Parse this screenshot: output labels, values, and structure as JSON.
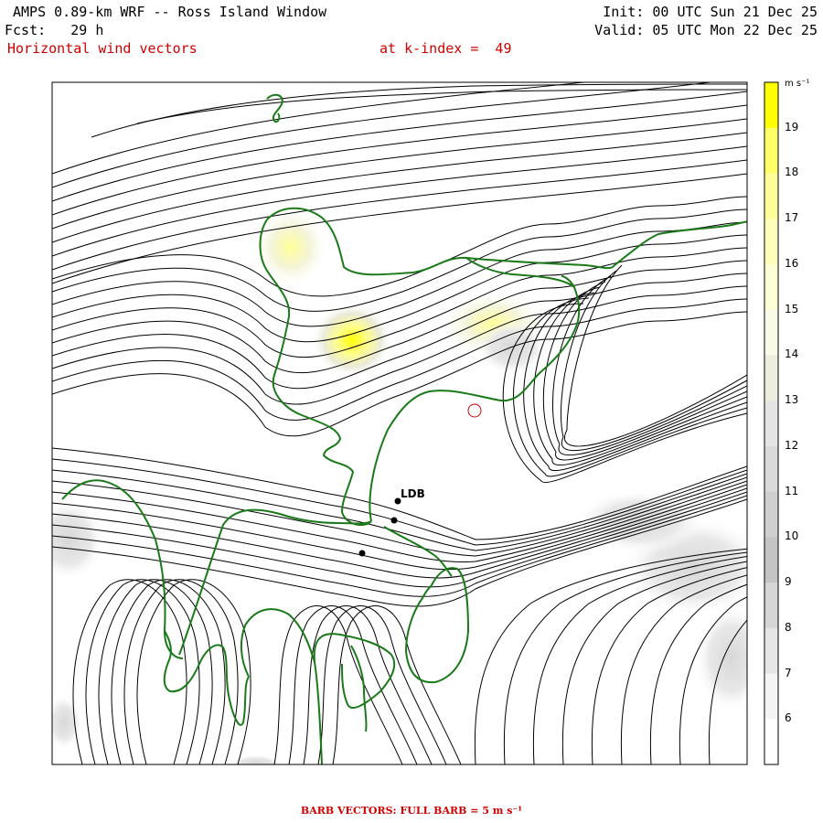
{
  "header": {
    "model_title": "AMPS 0.89-km WRF -- Ross Island Window",
    "init": "Init: 00 UTC Sun 21 Dec 25",
    "fcst": "Fcst:   29 h",
    "valid": "Valid: 05 UTC Mon 22 Dec 25",
    "field": "Horizontal wind vectors",
    "level": "at k-index =  49"
  },
  "colorbar": {
    "unit": "m s⁻¹",
    "labels": [
      "19",
      "18",
      "17",
      "16",
      "15",
      "14",
      "13",
      "12",
      "11",
      "10",
      "9",
      "8",
      "7",
      "6"
    ],
    "colors": [
      "#ffff00",
      "#ffff66",
      "#ffff99",
      "#ffffbb",
      "#ffffd6",
      "#fafae8",
      "#eeeede",
      "#e4e4e4",
      "#dadada",
      "#cfcfcf",
      "#c4c4c4",
      "#d6d6d6",
      "#e6e6e6",
      "#f4f4f4",
      "#ffffff"
    ]
  },
  "map": {
    "station_label": "LDB",
    "colors": {
      "contour": "#000000",
      "coast": "#1a7a1a",
      "barb": "#e00000"
    }
  },
  "footer": {
    "text": "BARB VECTORS:  FULL BARB = 5 m s⁻¹"
  }
}
